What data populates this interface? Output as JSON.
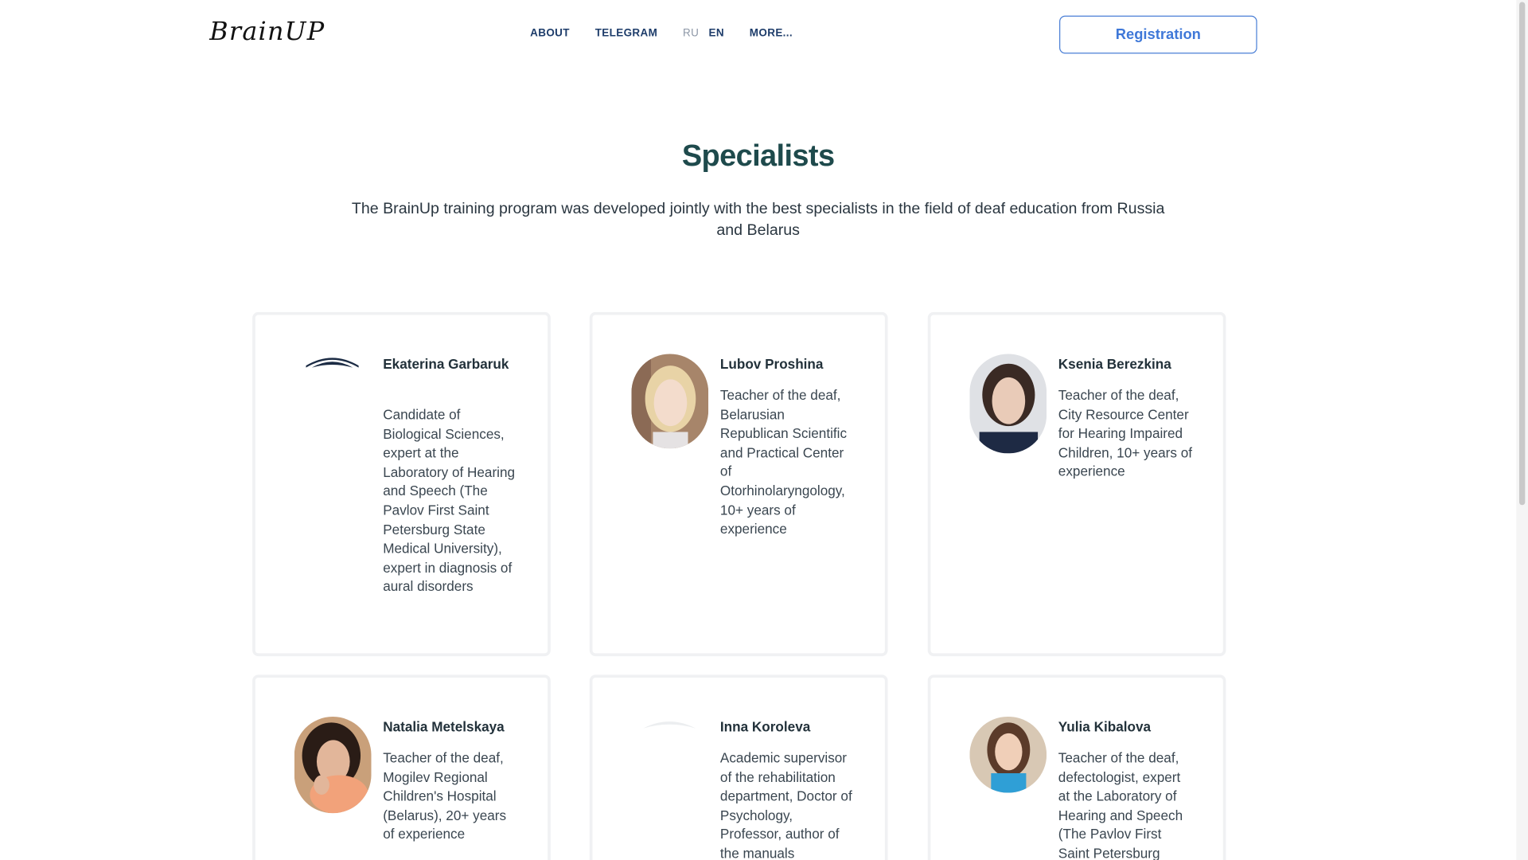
{
  "header": {
    "logo_text": "BrainUP",
    "nav": {
      "about": "ABOUT",
      "telegram": "TELEGRAM",
      "lang_ru": "RU",
      "lang_en": "EN",
      "more": "MORE..."
    },
    "registration_label": "Registration"
  },
  "section": {
    "title": "Specialists",
    "description": "The BrainUp training program was developed jointly with the best specialists in the field of deaf education from Russia and Belarus"
  },
  "specialists": [
    {
      "name": "Ekaterina Garbaruk",
      "text": "Candidate of Biological Sciences, expert at the Laboratory of Hearing and Speech (The Pavlov First Saint Petersburg State Medical University), expert in diagnosis of aural disorders"
    },
    {
      "name": "Lubov Proshina",
      "text": "Teacher of the deaf, Belarusian Republican Scientific and Practical Center of Otorhinolaryngology, 10+ years of experience"
    },
    {
      "name": "Ksenia Berezkina",
      "text": "Teacher of the deaf, City Resource Center for Hearing Impaired Children, 10+ years of experience"
    },
    {
      "name": "Natalia Metelskaya",
      "text": "Teacher of the deaf, Mogilev Regional Children's Hospital (Belarus), 20+ years of experience"
    },
    {
      "name": "Inna Koroleva",
      "text": "Academic supervisor of the rehabilitation department, Doctor of Psychology, Professor, author of the manuals"
    },
    {
      "name": "Yulia Kibalova",
      "text": "Teacher of the deaf, defectologist, expert at the Laboratory of Hearing and Speech (The Pavlov First Saint Petersburg"
    }
  ],
  "colors": {
    "title": "#1e4a4c",
    "nav": "#1d3c6a",
    "accent": "#3f78d8"
  }
}
